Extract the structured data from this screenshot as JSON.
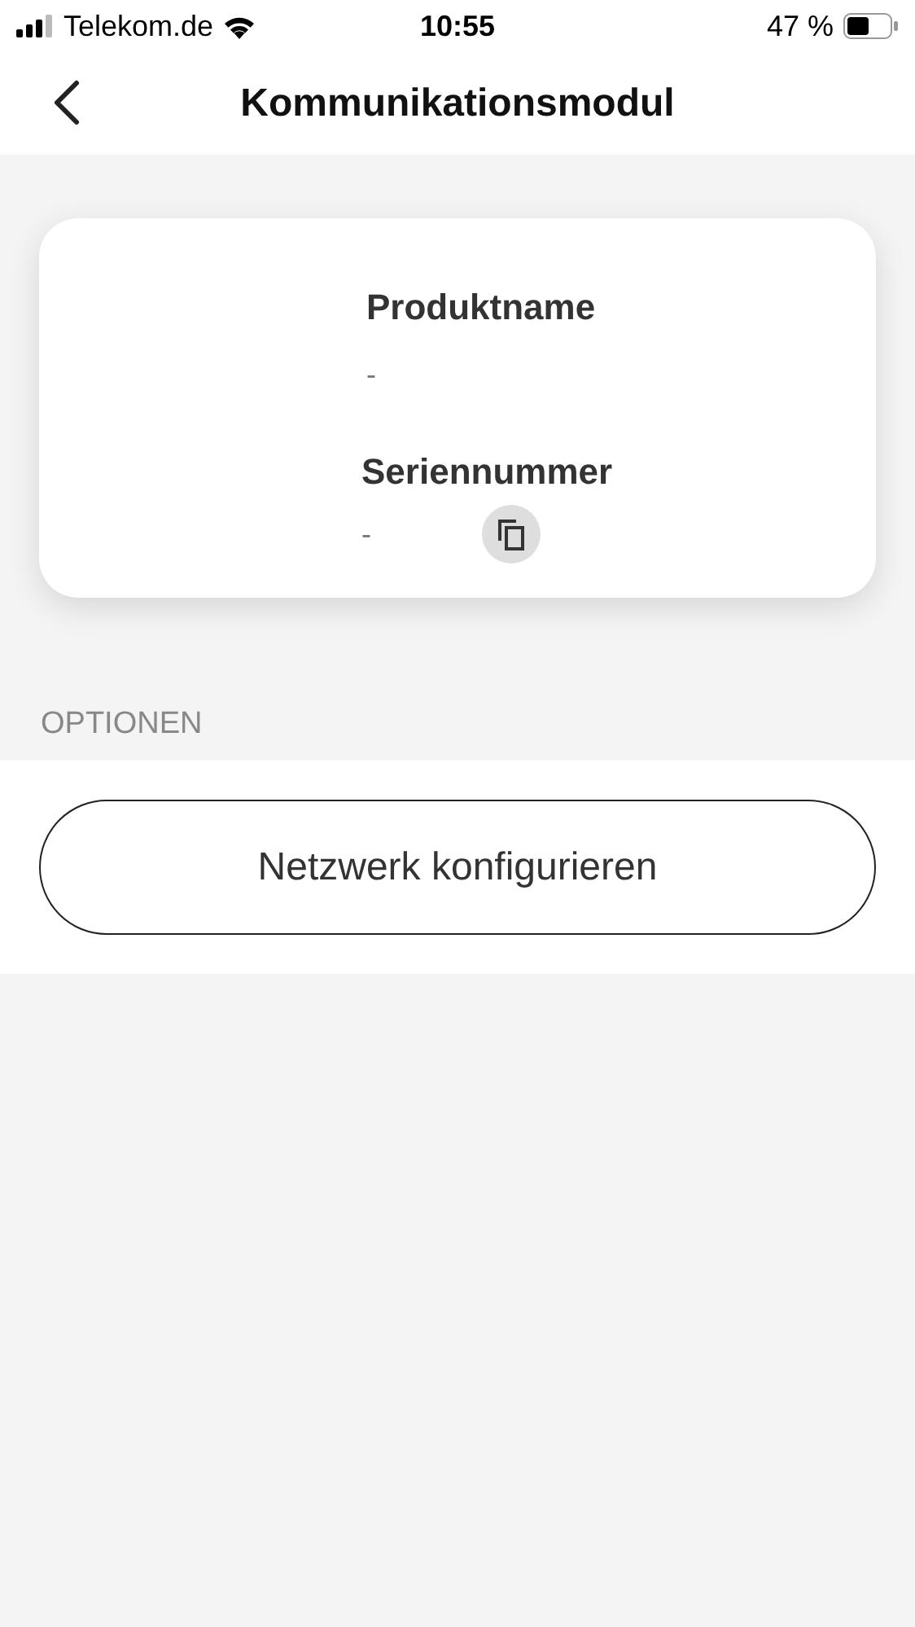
{
  "status_bar": {
    "carrier": "Telekom.de",
    "time": "10:55",
    "battery": "47 %"
  },
  "nav": {
    "title": "Kommunikationsmodul"
  },
  "card": {
    "fields": [
      {
        "label": "Produktname",
        "value": "-",
        "copyable": false
      },
      {
        "label": "Seriennummer",
        "value": "-",
        "copyable": true
      }
    ]
  },
  "section": {
    "title": "OPTIONEN"
  },
  "buttons": [
    "Netzwerk konfigurieren"
  ]
}
